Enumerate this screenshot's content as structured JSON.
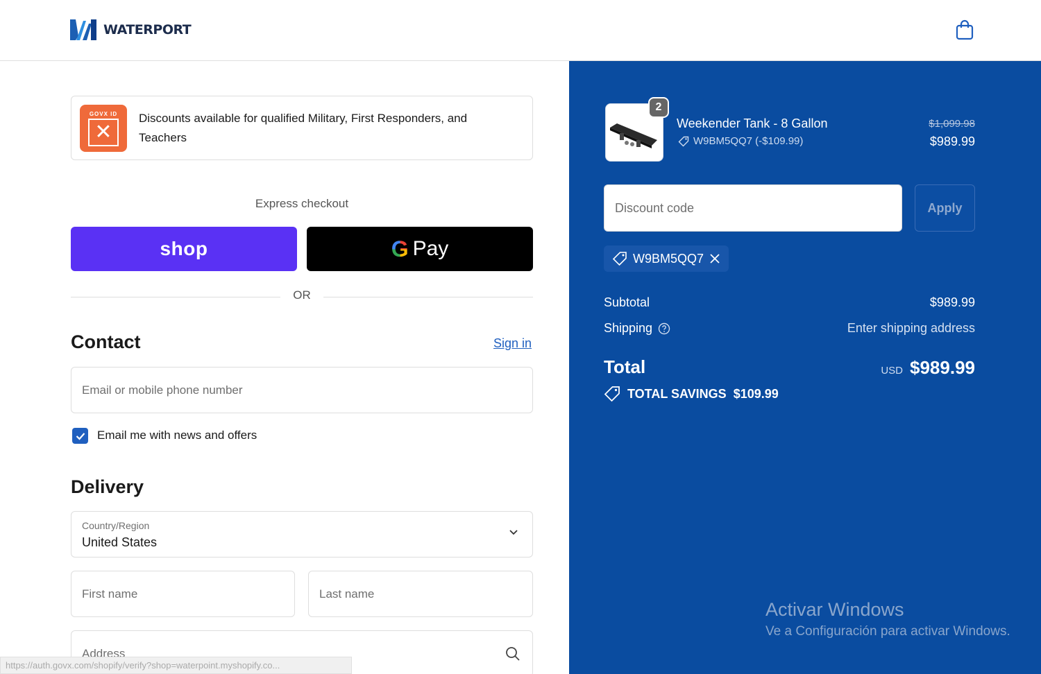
{
  "header": {
    "brand": "WATERPORT",
    "cart_icon": "shopping-bag-icon"
  },
  "promo": {
    "badge_label": "GOVX ID",
    "text": "Discounts available for qualified Military, First Responders, and Teachers"
  },
  "express": {
    "label": "Express checkout",
    "shop_label": "shop",
    "gpay_g": "G",
    "gpay_label": "Pay",
    "or_label": "OR"
  },
  "contact": {
    "title": "Contact",
    "signin_label": "Sign in",
    "email_placeholder": "Email or mobile phone number",
    "newsletter_label": "Email me with news and offers",
    "newsletter_checked": true
  },
  "delivery": {
    "title": "Delivery",
    "country_label": "Country/Region",
    "country_value": "United States",
    "first_name_placeholder": "First name",
    "last_name_placeholder": "Last name",
    "address_placeholder": "Address"
  },
  "status_bar": {
    "url": "https://auth.govx.com/shopify/verify?shop=waterpoint.myshopify.co..."
  },
  "order": {
    "item": {
      "name": "Weekender Tank - 8 Gallon",
      "quantity": "2",
      "discount_code": "W9BM5QQ7 (-$109.99)",
      "original_price": "$1,099.98",
      "price": "$989.99"
    },
    "discount_placeholder": "Discount code",
    "apply_label": "Apply",
    "applied_code": "W9BM5QQ7",
    "subtotal_label": "Subtotal",
    "subtotal_value": "$989.99",
    "shipping_label": "Shipping",
    "shipping_value": "Enter shipping address",
    "total_label": "Total",
    "currency": "USD",
    "total_value": "$989.99",
    "savings_label": "TOTAL SAVINGS",
    "savings_value": "$109.99"
  },
  "watermark": {
    "title": "Activar Windows",
    "subtitle": "Ve a Configuración para activar Windows."
  },
  "colors": {
    "accent_blue": "#1f5fbf",
    "summary_bg": "#0a4ca0",
    "shop_purple": "#5a31f4",
    "govx_orange": "#ef6a3a"
  }
}
